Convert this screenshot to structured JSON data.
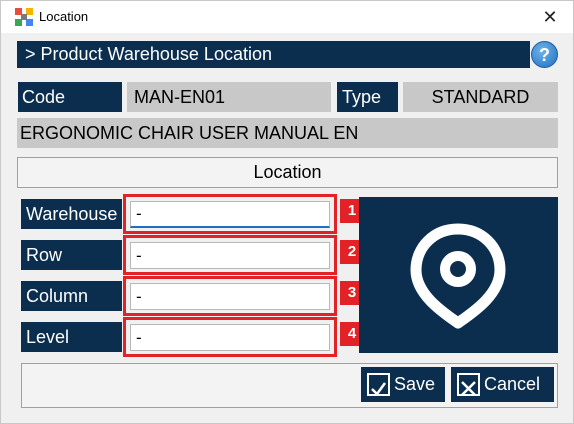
{
  "window": {
    "title": "Location",
    "close_glyph": "✕",
    "app_icon": "app-logo-icon"
  },
  "header": {
    "title": "> Product Warehouse Location",
    "help_glyph": "?"
  },
  "product": {
    "code_label": "Code",
    "code_value": "MAN-EN01",
    "type_label": "Type",
    "type_value": "STANDARD",
    "description": "ERGONOMIC CHAIR USER MANUAL EN"
  },
  "section": {
    "title": "Location"
  },
  "fields": [
    {
      "label": "Warehouse",
      "value": "-",
      "badge": "1"
    },
    {
      "label": "Row",
      "value": "-",
      "badge": "2"
    },
    {
      "label": "Column",
      "value": "-",
      "badge": "3"
    },
    {
      "label": "Level",
      "value": "-",
      "badge": "4"
    }
  ],
  "panel": {
    "icon": "location-pin-icon"
  },
  "footer": {
    "save_label": "Save",
    "cancel_label": "Cancel"
  },
  "colors": {
    "navy": "#0b2e4f",
    "grey": "#c8c8c8",
    "highlight_red": "#e32228",
    "help_blue": "#1f6fc0"
  }
}
